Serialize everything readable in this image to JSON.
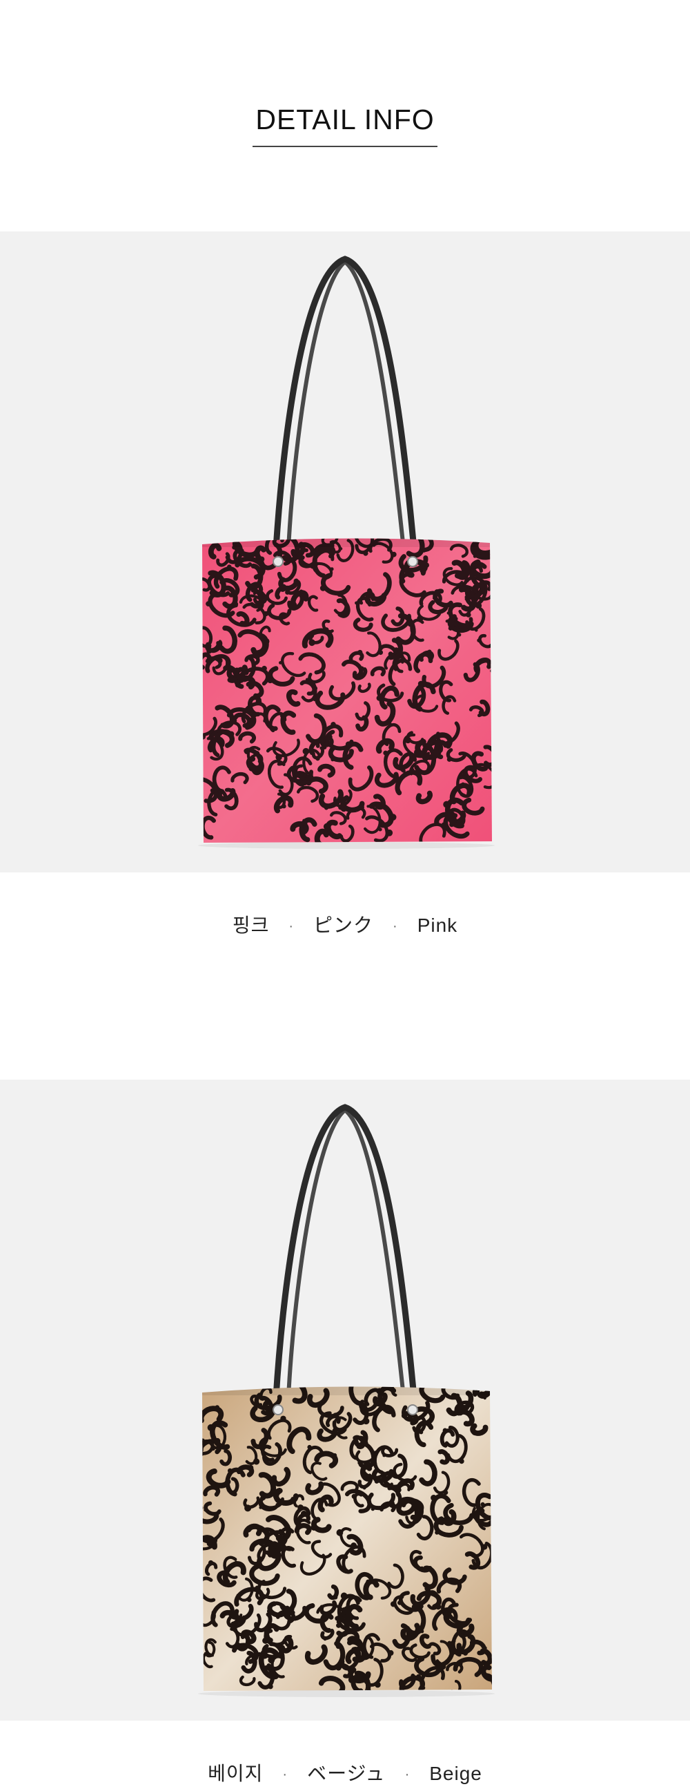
{
  "header": {
    "title": "DETAIL INFO"
  },
  "products": [
    {
      "color_ko": "핑크",
      "color_ja": "ピンク",
      "color_en": "Pink",
      "separator": "·",
      "palette": {
        "base": "#f05078",
        "base_light": "#f36d8d",
        "spot": "#2a1518",
        "handle": "#2b2b2b"
      }
    },
    {
      "color_ko": "베이지",
      "color_ja": "ベージュ",
      "color_en": "Beige",
      "separator": "·",
      "palette": {
        "base": "#c8a378",
        "base_light": "#ece0cf",
        "spot": "#1e1410",
        "handle": "#2b2b2b"
      }
    }
  ]
}
